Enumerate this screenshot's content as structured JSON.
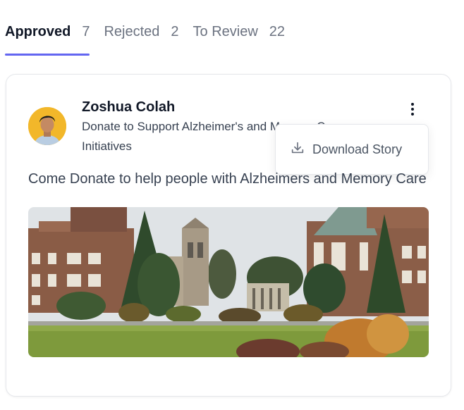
{
  "tabs": [
    {
      "label": "Approved",
      "count": "7",
      "active": true
    },
    {
      "label": "Rejected",
      "count": "2",
      "active": false
    },
    {
      "label": "To Review",
      "count": "22",
      "active": false
    }
  ],
  "colors": {
    "accent": "#6366f1"
  },
  "story": {
    "author": "Zoshua Colah",
    "campaign": "Donate to Support Alzheimer's and Memory Care Initiatives",
    "body": "Come Donate to help people with Alzheimers and Memory Care",
    "image_icon": "campus-photo"
  },
  "menu": {
    "items": [
      {
        "label": "Download Story",
        "icon": "download-icon"
      }
    ]
  }
}
